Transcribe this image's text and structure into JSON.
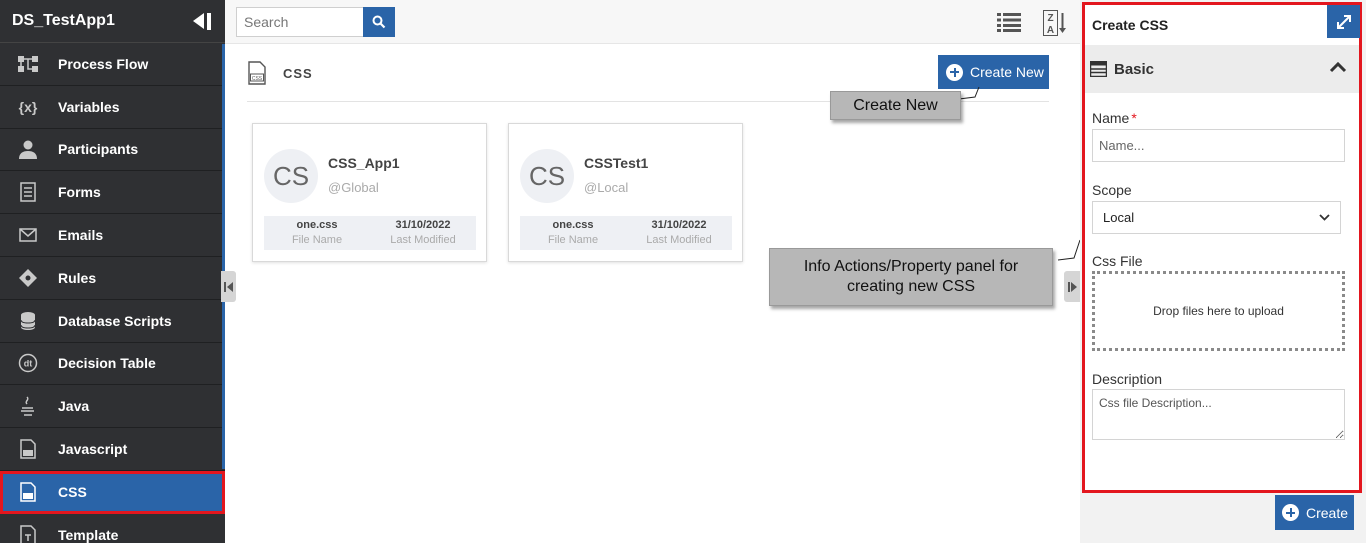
{
  "app": {
    "title": "DS_TestApp1"
  },
  "sidebar": {
    "items": [
      {
        "label": "Process Flow",
        "icon": "process-flow-icon"
      },
      {
        "label": "Variables",
        "icon": "variables-icon"
      },
      {
        "label": "Participants",
        "icon": "participants-icon"
      },
      {
        "label": "Forms",
        "icon": "forms-icon"
      },
      {
        "label": "Emails",
        "icon": "emails-icon"
      },
      {
        "label": "Rules",
        "icon": "rules-icon"
      },
      {
        "label": "Database Scripts",
        "icon": "database-icon"
      },
      {
        "label": "Decision Table",
        "icon": "decision-table-icon"
      },
      {
        "label": "Java",
        "icon": "java-icon"
      },
      {
        "label": "Javascript",
        "icon": "javascript-icon"
      },
      {
        "label": "CSS",
        "icon": "css-file-icon"
      },
      {
        "label": "Template",
        "icon": "template-icon"
      }
    ],
    "active": "CSS"
  },
  "topbar": {
    "search_placeholder": "Search"
  },
  "page": {
    "title": "CSS",
    "create_new_label": "Create New"
  },
  "callouts": {
    "create_new": "Create New",
    "panel_line1": "Info Actions/Property panel for",
    "panel_line2": "creating new CSS"
  },
  "cards": [
    {
      "initials": "CS",
      "name": "CSS_App1",
      "scope": "@Global",
      "file": "one.css",
      "file_key": "File Name",
      "modified": "31/10/2022",
      "modified_key": "Last Modified"
    },
    {
      "initials": "CS",
      "name": "CSSTest1",
      "scope": "@Local",
      "file": "one.css",
      "file_key": "File Name",
      "modified": "31/10/2022",
      "modified_key": "Last Modified"
    }
  ],
  "panel": {
    "title": "Create CSS",
    "section": "Basic",
    "name_label": "Name",
    "name_required": "*",
    "name_placeholder": "Name...",
    "scope_label": "Scope",
    "scope_value": "Local",
    "file_label": "Css File",
    "drop_text": "Drop files here to upload",
    "description_label": "Description",
    "description_placeholder": "Css file Description...",
    "create_label": "Create"
  },
  "colors": {
    "accent": "#2a64a8",
    "highlight": "#e3161e",
    "sidebar_bg": "#2f3033"
  }
}
